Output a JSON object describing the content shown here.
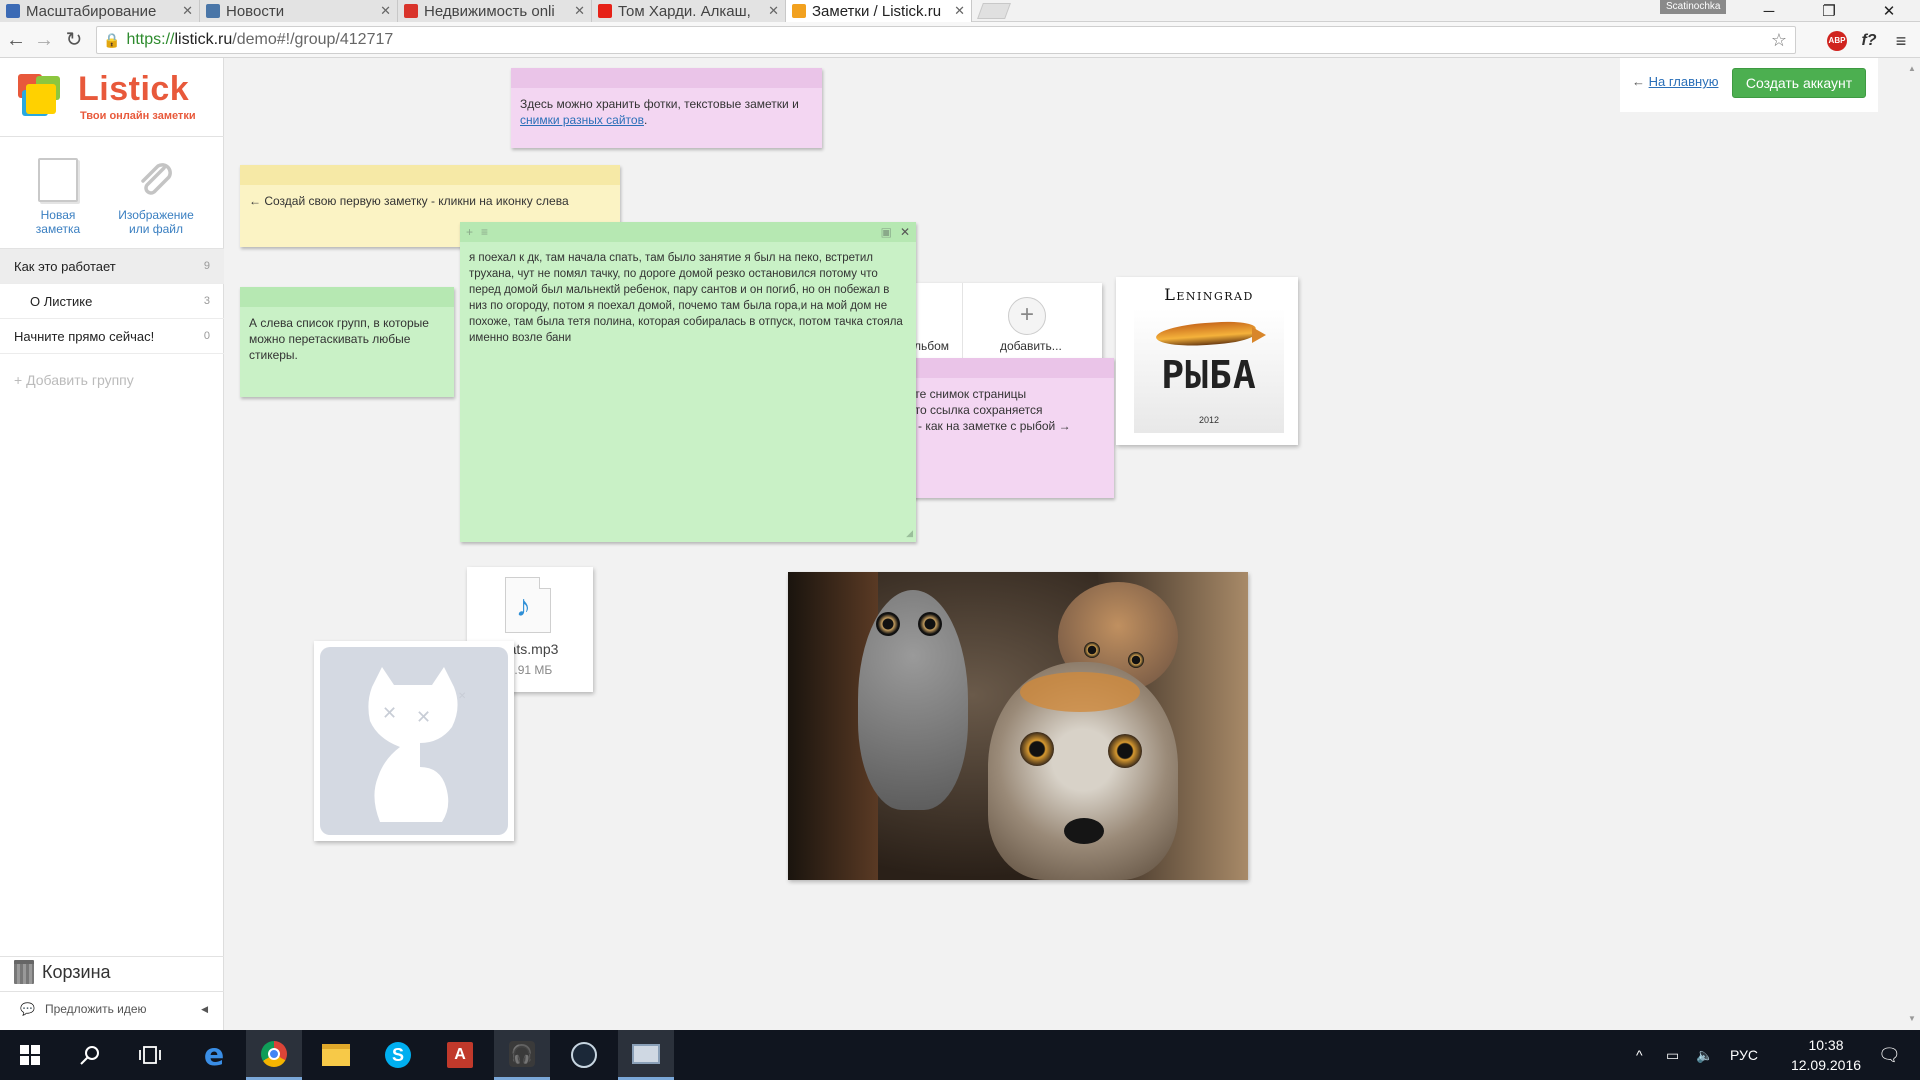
{
  "browser": {
    "tabs": [
      {
        "label": "Масштабирование",
        "favicon_color": "#3b6ab5"
      },
      {
        "label": "Новости",
        "favicon_color": "#4a76a8"
      },
      {
        "label": "Недвижимость onli",
        "favicon_color": "#d9342b"
      },
      {
        "label": "Том Харди. Алкаш,",
        "favicon_color": "#e62117"
      },
      {
        "label": "Заметки / Listick.ru",
        "favicon_color": "#f2a11f"
      }
    ],
    "profile": "Scatinochka",
    "url_proto": "https://",
    "url_host": "listick.ru",
    "url_path": "/demo#!/group/412717",
    "abp_label": "ABP",
    "fx_label": "f?"
  },
  "sidebar": {
    "logo_title": "Listick",
    "logo_tagline": "Твои онлайн заметки",
    "new_note_line1": "Новая",
    "new_note_line2": "заметка",
    "attach_line1": "Изображение",
    "attach_line2": "или файл",
    "groups": [
      {
        "label": "Как это работает",
        "count": "9"
      },
      {
        "label": "О Листике",
        "count": "3"
      },
      {
        "label": "Начните прямо сейчас!",
        "count": "0"
      }
    ],
    "add_group": "Добавить группу",
    "trash": "Корзина",
    "idea": "Предложить идею"
  },
  "topright": {
    "home_arrow": "←",
    "home_link": "На главную",
    "create_account": "Создать аккаунт"
  },
  "notes": {
    "pink_top_text": "Здесь можно хранить фотки, текстовые заметки и ",
    "pink_top_link": "снимки разных сайтов",
    "pink_top_tail": ".",
    "yellow_text": "← Создай свою первую заметку - кликни на иконку слева",
    "green_small_text": "А слева список групп, в которые можно перетаскивать любые стикеры.",
    "green_big_text": "я поехал к дк, там начала спать, там было занятие я был на пеко, встретил трухана, чут не помял тачку, по дороге домой резко остановился потому что перед домой был мальнекtй ребенок, пару сантов и он погиб, но он побежал в низ по огороду, потом я поехал домой, почемо там была гора,и на мой дом не похоже, там была тетя полина, которая собиралась в отпуск, потом тачка стояла именно возле бани",
    "pink_mid_line1": "ете снимок страницы",
    "pink_mid_line2": ", то ссылка сохраняется",
    "pink_mid_line3": "и - как на заметке с рыбой →",
    "album_label": "льбом",
    "add_label": "добавить...",
    "leningrad_title": "Leningrad",
    "leningrad_word": "РЫБА",
    "leningrad_year": "2012",
    "file_name": "cats.mp3",
    "file_size": "3.91 МБ"
  },
  "taskbar": {
    "lang": "РУС",
    "time": "10:38",
    "date": "12.09.2016"
  }
}
